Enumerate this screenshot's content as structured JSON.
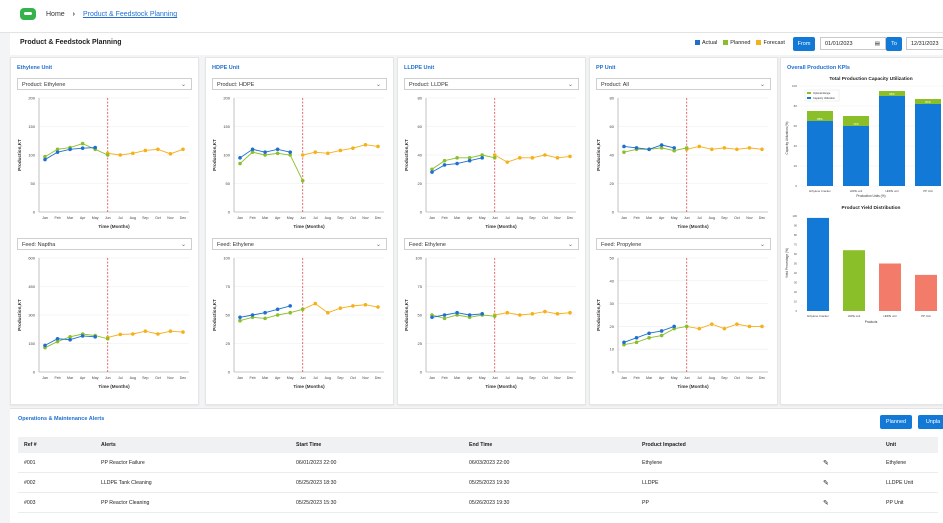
{
  "breadcrumb": {
    "home": "Home",
    "current": "Product & Feedstock Planning"
  },
  "page_title": "Product & Feedstock Planning",
  "legend": [
    {
      "label": "Actual",
      "color": "#1f6fd1"
    },
    {
      "label": "Planned",
      "color": "#8bbf2a"
    },
    {
      "label": "Forecast",
      "color": "#f5b01a"
    }
  ],
  "filters": {
    "from_label": "From",
    "from_date": "01/01/2023",
    "to_label": "To",
    "to_date": "12/31/2023"
  },
  "months": [
    "Jan",
    "Feb",
    "Mar",
    "Apr",
    "May",
    "Jun",
    "Jul",
    "Aug",
    "Sep",
    "Oct",
    "Nov",
    "Dec"
  ],
  "x_axis_label": "Time (Months)",
  "y_axis_label": "Production,KT",
  "colors": {
    "actual": "#1f6fd1",
    "planned": "#8bbf2a",
    "forecast": "#f5b01a",
    "cutoff": "#e04646"
  },
  "units": [
    {
      "title": "Ethylene Unit",
      "product_select": "Product: Ethylene",
      "feed_select": "Feed: Naptha",
      "chart_data": [
        {
          "type": "line",
          "ylim": [
            0,
            200
          ],
          "yticks": [
            0,
            50,
            100,
            150,
            200
          ],
          "series": [
            {
              "name": "Actual",
              "points": [
                [
                  1,
                  92
                ],
                [
                  2,
                  105
                ],
                [
                  3,
                  110
                ],
                [
                  4,
                  112
                ],
                [
                  5,
                  113
                ]
              ]
            },
            {
              "name": "Planned",
              "points": [
                [
                  1,
                  97
                ],
                [
                  2,
                  110
                ],
                [
                  3,
                  113
                ],
                [
                  4,
                  120
                ],
                [
                  5,
                  110
                ],
                [
                  6,
                  100
                ]
              ]
            },
            {
              "name": "Forecast",
              "points": [
                [
                  6,
                  103
                ],
                [
                  7,
                  100
                ],
                [
                  8,
                  103
                ],
                [
                  9,
                  108
                ],
                [
                  10,
                  110
                ],
                [
                  11,
                  102
                ],
                [
                  12,
                  110
                ]
              ]
            }
          ]
        },
        {
          "type": "line",
          "ylim": [
            0,
            600
          ],
          "yticks": [
            0,
            150,
            300,
            450,
            600
          ],
          "series": [
            {
              "name": "Actual",
              "points": [
                [
                  1,
                  140
                ],
                [
                  2,
                  175
                ],
                [
                  3,
                  170
                ],
                [
                  4,
                  190
                ],
                [
                  5,
                  185
                ]
              ]
            },
            {
              "name": "Planned",
              "points": [
                [
                  1,
                  128
                ],
                [
                  2,
                  160
                ],
                [
                  3,
                  185
                ],
                [
                  4,
                  200
                ],
                [
                  5,
                  192
                ],
                [
                  6,
                  175
                ]
              ]
            },
            {
              "name": "Forecast",
              "points": [
                [
                  6,
                  182
                ],
                [
                  7,
                  198
                ],
                [
                  8,
                  200
                ],
                [
                  9,
                  215
                ],
                [
                  10,
                  200
                ],
                [
                  11,
                  215
                ],
                [
                  12,
                  210
                ]
              ]
            }
          ]
        }
      ]
    },
    {
      "title": "HDPE Unit",
      "product_select": "Product: HDPE",
      "feed_select": "Feed: Ethylene",
      "chart_data": [
        {
          "type": "line",
          "ylim": [
            0,
            200
          ],
          "yticks": [
            0,
            50,
            100,
            150,
            200
          ],
          "series": [
            {
              "name": "Actual",
              "points": [
                [
                  1,
                  95
                ],
                [
                  2,
                  110
                ],
                [
                  3,
                  105
                ],
                [
                  4,
                  110
                ],
                [
                  5,
                  105
                ]
              ]
            },
            {
              "name": "Planned",
              "points": [
                [
                  1,
                  85
                ],
                [
                  2,
                  105
                ],
                [
                  3,
                  100
                ],
                [
                  4,
                  103
                ],
                [
                  5,
                  100
                ],
                [
                  6,
                  55
                ]
              ]
            },
            {
              "name": "Forecast",
              "points": [
                [
                  6,
                  100
                ],
                [
                  7,
                  105
                ],
                [
                  8,
                  103
                ],
                [
                  9,
                  108
                ],
                [
                  10,
                  112
                ],
                [
                  11,
                  118
                ],
                [
                  12,
                  115
                ]
              ]
            }
          ]
        },
        {
          "type": "line",
          "ylim": [
            0,
            100
          ],
          "yticks": [
            0,
            25,
            50,
            75,
            100
          ],
          "series": [
            {
              "name": "Actual",
              "points": [
                [
                  1,
                  48
                ],
                [
                  2,
                  50
                ],
                [
                  3,
                  52
                ],
                [
                  4,
                  55
                ],
                [
                  5,
                  58
                ]
              ]
            },
            {
              "name": "Planned",
              "points": [
                [
                  1,
                  45
                ],
                [
                  2,
                  48
                ],
                [
                  3,
                  47
                ],
                [
                  4,
                  50
                ],
                [
                  5,
                  52
                ],
                [
                  6,
                  55
                ]
              ]
            },
            {
              "name": "Forecast",
              "points": [
                [
                  6,
                  55
                ],
                [
                  7,
                  60
                ],
                [
                  8,
                  52
                ],
                [
                  9,
                  56
                ],
                [
                  10,
                  58
                ],
                [
                  11,
                  59
                ],
                [
                  12,
                  57
                ]
              ]
            }
          ]
        }
      ]
    },
    {
      "title": "LLDPE Unit",
      "product_select": "Product: LLDPE",
      "feed_select": "Feed: Ethylene",
      "chart_data": [
        {
          "type": "line",
          "ylim": [
            0,
            80
          ],
          "yticks": [
            0,
            20,
            40,
            60,
            80
          ],
          "series": [
            {
              "name": "Actual",
              "points": [
                [
                  1,
                  28
                ],
                [
                  2,
                  33
                ],
                [
                  3,
                  34
                ],
                [
                  4,
                  36
                ],
                [
                  5,
                  38
                ]
              ]
            },
            {
              "name": "Planned",
              "points": [
                [
                  1,
                  30
                ],
                [
                  2,
                  36
                ],
                [
                  3,
                  38
                ],
                [
                  4,
                  38
                ],
                [
                  5,
                  40
                ],
                [
                  6,
                  38
                ]
              ]
            },
            {
              "name": "Forecast",
              "points": [
                [
                  6,
                  40
                ],
                [
                  7,
                  35
                ],
                [
                  8,
                  38
                ],
                [
                  9,
                  38
                ],
                [
                  10,
                  40
                ],
                [
                  11,
                  38
                ],
                [
                  12,
                  39
                ]
              ]
            }
          ]
        },
        {
          "type": "line",
          "ylim": [
            0,
            100
          ],
          "yticks": [
            0,
            25,
            50,
            75,
            100
          ],
          "series": [
            {
              "name": "Actual",
              "points": [
                [
                  1,
                  48
                ],
                [
                  2,
                  50
                ],
                [
                  3,
                  52
                ],
                [
                  4,
                  50
                ],
                [
                  5,
                  51
                ]
              ]
            },
            {
              "name": "Planned",
              "points": [
                [
                  1,
                  50
                ],
                [
                  2,
                  47
                ],
                [
                  3,
                  50
                ],
                [
                  4,
                  48
                ],
                [
                  5,
                  50
                ],
                [
                  6,
                  49
                ]
              ]
            },
            {
              "name": "Forecast",
              "points": [
                [
                  6,
                  50
                ],
                [
                  7,
                  52
                ],
                [
                  8,
                  50
                ],
                [
                  9,
                  51
                ],
                [
                  10,
                  53
                ],
                [
                  11,
                  51
                ],
                [
                  12,
                  52
                ]
              ]
            }
          ]
        }
      ]
    },
    {
      "title": "PP Unit",
      "product_select": "Product: All",
      "feed_select": "Feed: Propylene",
      "chart_data": [
        {
          "type": "line",
          "ylim": [
            0,
            80
          ],
          "yticks": [
            0,
            20,
            40,
            60,
            80
          ],
          "series": [
            {
              "name": "Actual",
              "points": [
                [
                  1,
                  46
                ],
                [
                  2,
                  45
                ],
                [
                  3,
                  44
                ],
                [
                  4,
                  47
                ],
                [
                  5,
                  45
                ]
              ]
            },
            {
              "name": "Planned",
              "points": [
                [
                  1,
                  42
                ],
                [
                  2,
                  44
                ],
                [
                  3,
                  44
                ],
                [
                  4,
                  45
                ],
                [
                  5,
                  43
                ],
                [
                  6,
                  45
                ]
              ]
            },
            {
              "name": "Forecast",
              "points": [
                [
                  6,
                  44
                ],
                [
                  7,
                  46
                ],
                [
                  8,
                  44
                ],
                [
                  9,
                  45
                ],
                [
                  10,
                  44
                ],
                [
                  11,
                  45
                ],
                [
                  12,
                  44
                ]
              ]
            }
          ]
        },
        {
          "type": "line",
          "ylim": [
            0,
            50
          ],
          "yticks": [
            0,
            10,
            20,
            30,
            40,
            50
          ],
          "series": [
            {
              "name": "Actual",
              "points": [
                [
                  1,
                  13
                ],
                [
                  2,
                  15
                ],
                [
                  3,
                  17
                ],
                [
                  4,
                  18
                ],
                [
                  5,
                  20
                ]
              ]
            },
            {
              "name": "Planned",
              "points": [
                [
                  1,
                  12
                ],
                [
                  2,
                  13
                ],
                [
                  3,
                  15
                ],
                [
                  4,
                  16
                ],
                [
                  5,
                  19
                ],
                [
                  6,
                  20
                ]
              ]
            },
            {
              "name": "Forecast",
              "points": [
                [
                  6,
                  20
                ],
                [
                  7,
                  19
                ],
                [
                  8,
                  21
                ],
                [
                  9,
                  19
                ],
                [
                  10,
                  21
                ],
                [
                  11,
                  20
                ],
                [
                  12,
                  20
                ]
              ]
            }
          ]
        }
      ]
    }
  ],
  "kpi": {
    "title": "Overall Production KPIs",
    "capacity_chart": {
      "title": "Total Production Capacity Utilization",
      "xlabel": "Production Units (%)",
      "ylabel": "Capacity Utilization (%)",
      "legend": [
        "Optimal Range",
        "Capacity Utilization"
      ],
      "categories": [
        "Ethylene Cracker",
        "LDPE unit",
        "HDPE unit",
        "PP Unit"
      ],
      "chart_data": {
        "type": "bar",
        "ylim": [
          0,
          100
        ],
        "series": [
          {
            "name": "Capacity Utilization",
            "values": [
              65,
              60,
              90,
              82
            ]
          },
          {
            "name": "Optimal Range",
            "values": [
              10,
              10,
              5,
              5
            ]
          }
        ],
        "labels": [
          "85%",
          "72%",
          "95%",
          "87%"
        ]
      }
    },
    "yield_chart": {
      "title": "Product Yield Distribution",
      "xlabel": "Products",
      "ylabel": "Yield Percentage (%)",
      "categories": [
        "Ethylene Cracker",
        "LDPE unit",
        "HDPE unit",
        "PP Unit"
      ],
      "chart_data": {
        "type": "bar",
        "ylim": [
          0,
          100
        ],
        "values": [
          98,
          64,
          50,
          38
        ],
        "colors": [
          "#1379d6",
          "#8bbf2a",
          "#f37b6a",
          "#f37b6a"
        ]
      }
    }
  },
  "alerts": {
    "title": "Operations & Maintenance Alerts",
    "planned_button": "Planned",
    "unplanned_button": "Unpla",
    "columns": [
      "Ref #",
      "Alerts",
      "Start Time",
      "End Time",
      "Product Impacted",
      "",
      "Unit"
    ],
    "rows": [
      {
        "ref": "#001",
        "alert": "PP Reactor Failure",
        "start": "06/01/2023 22:00",
        "end": "06/03/2023 22:00",
        "product": "Ethylene",
        "unit": "Ethylene"
      },
      {
        "ref": "#002",
        "alert": "LLDPE Tank Cleaning",
        "start": "05/25/2023 18:30",
        "end": "05/25/2023 19:30",
        "product": "LLDPE",
        "unit": "LLDPE Unit"
      },
      {
        "ref": "#003",
        "alert": "PP Reactor Cleaning",
        "start": "05/25/2023 15:30",
        "end": "05/26/2023 19:30",
        "product": "PP",
        "unit": "PP Unit"
      }
    ]
  }
}
